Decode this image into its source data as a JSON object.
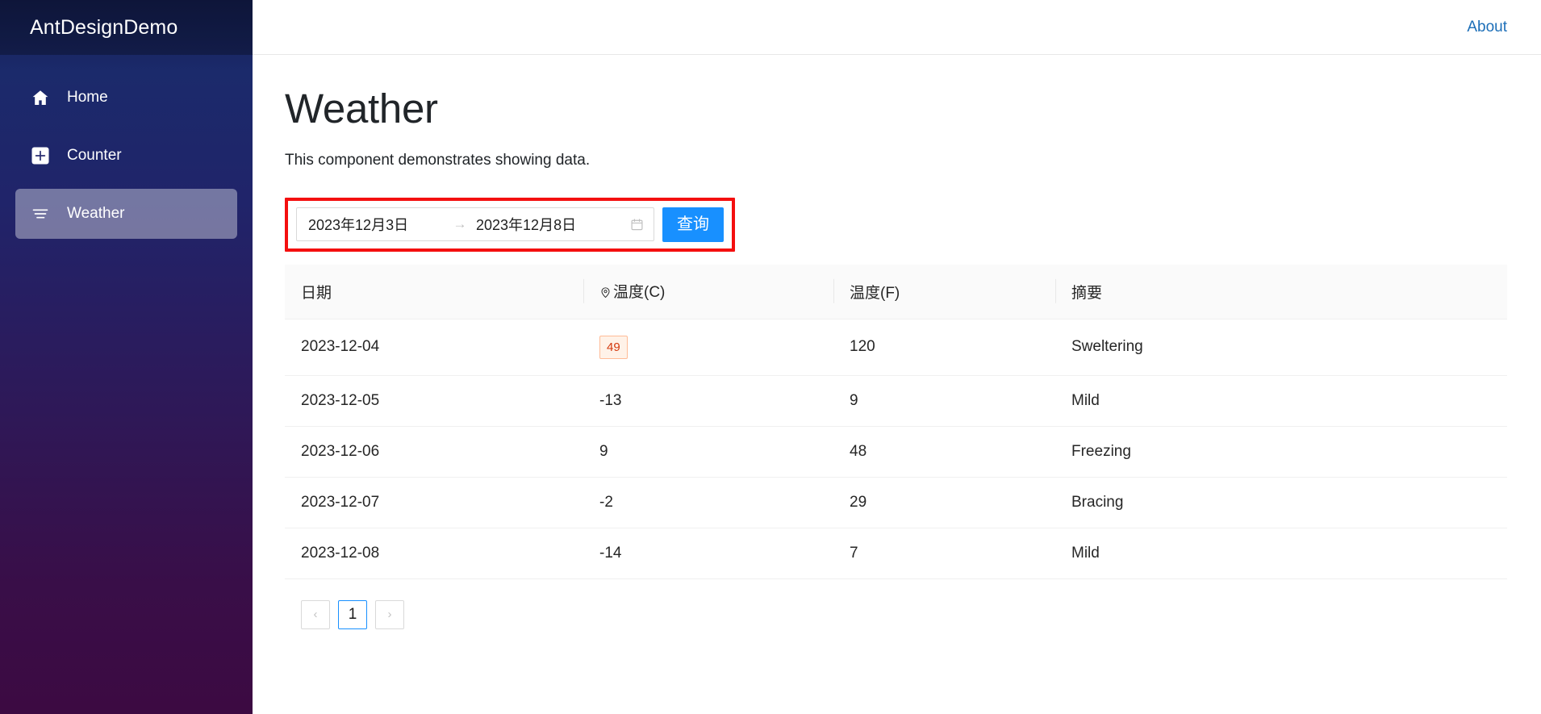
{
  "sidebar": {
    "brand": "AntDesignDemo",
    "items": [
      {
        "label": "Home",
        "icon": "home-icon",
        "active": false
      },
      {
        "label": "Counter",
        "icon": "plus-square-icon",
        "active": false
      },
      {
        "label": "Weather",
        "icon": "list-icon",
        "active": true
      }
    ]
  },
  "topbar": {
    "about_label": "About"
  },
  "page": {
    "title": "Weather",
    "description": "This component demonstrates showing data."
  },
  "filter": {
    "start_date": "2023年12月3日",
    "end_date": "2023年12月8日",
    "separator": "→",
    "calendar_icon": "calendar-icon",
    "query_label": "查询",
    "highlight_color": "#f40f0f",
    "button_color": "#1890ff"
  },
  "table": {
    "columns": [
      {
        "key": "date",
        "label": "日期",
        "icon": null
      },
      {
        "key": "celsius",
        "label": "温度(C)",
        "icon": "location-pin-icon"
      },
      {
        "key": "fahrenheit",
        "label": "温度(F)",
        "icon": null
      },
      {
        "key": "summary",
        "label": "摘要",
        "icon": null
      }
    ],
    "rows": [
      {
        "date": "2023-12-04",
        "celsius": "49",
        "celsius_tagged": true,
        "fahrenheit": "120",
        "summary": "Sweltering"
      },
      {
        "date": "2023-12-05",
        "celsius": "-13",
        "celsius_tagged": false,
        "fahrenheit": "9",
        "summary": "Mild"
      },
      {
        "date": "2023-12-06",
        "celsius": "9",
        "celsius_tagged": false,
        "fahrenheit": "48",
        "summary": "Freezing"
      },
      {
        "date": "2023-12-07",
        "celsius": "-2",
        "celsius_tagged": false,
        "fahrenheit": "29",
        "summary": "Bracing"
      },
      {
        "date": "2023-12-08",
        "celsius": "-14",
        "celsius_tagged": false,
        "fahrenheit": "7",
        "summary": "Mild"
      }
    ]
  },
  "pagination": {
    "prev_label": "‹",
    "next_label": "›",
    "pages": [
      "1"
    ],
    "current": "1"
  }
}
